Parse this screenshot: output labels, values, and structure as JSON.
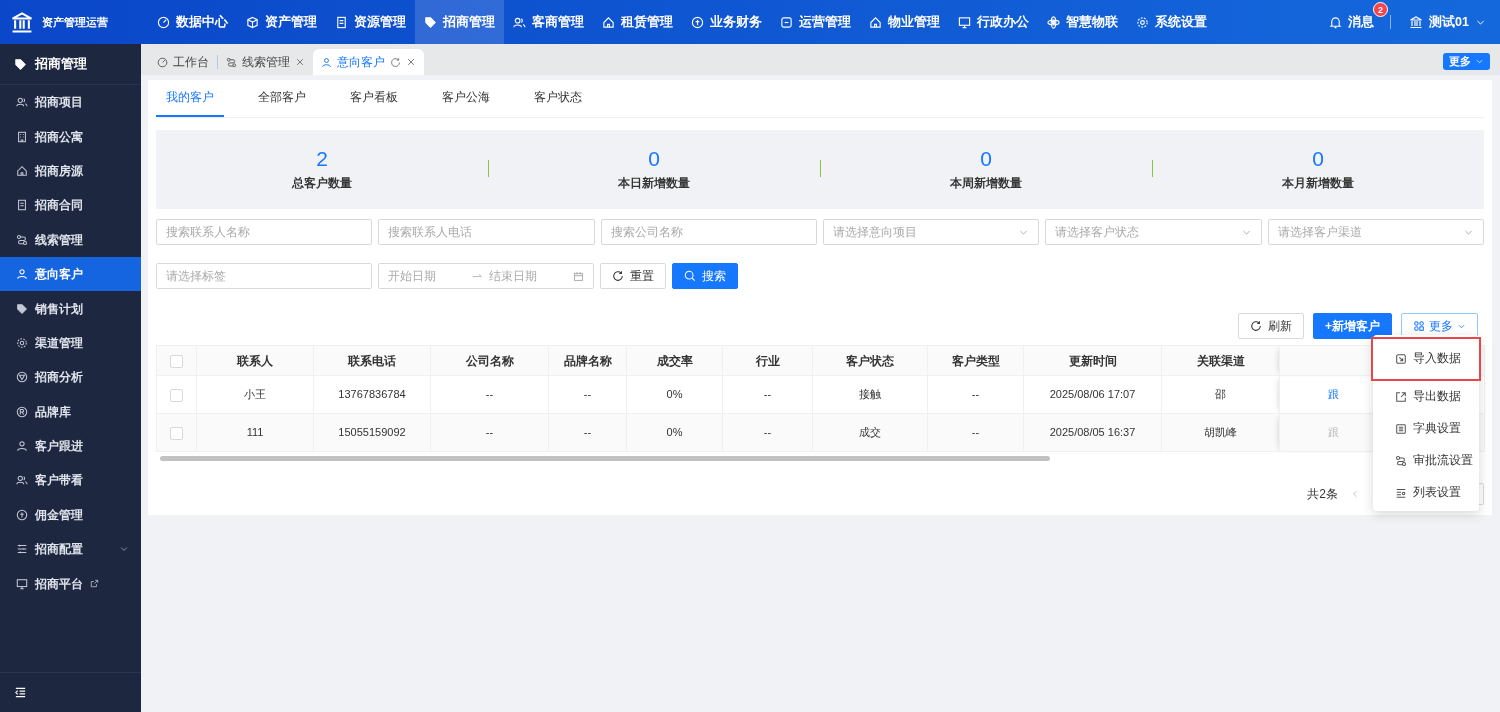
{
  "app": {
    "title": "资产管理运营"
  },
  "top_nav": [
    {
      "label": "数据中心",
      "selected": false
    },
    {
      "label": "资产管理",
      "selected": false
    },
    {
      "label": "资源管理",
      "selected": false
    },
    {
      "label": "招商管理",
      "selected": true
    },
    {
      "label": "客商管理",
      "selected": false
    },
    {
      "label": "租赁管理",
      "selected": false
    },
    {
      "label": "业务财务",
      "selected": false
    },
    {
      "label": "运营管理",
      "selected": false
    },
    {
      "label": "物业管理",
      "selected": false
    },
    {
      "label": "行政办公",
      "selected": false
    },
    {
      "label": "智慧物联",
      "selected": false
    },
    {
      "label": "系统设置",
      "selected": false
    }
  ],
  "notifications": {
    "label": "消息",
    "count": "2"
  },
  "user": {
    "name": "测试01"
  },
  "sidebar": {
    "title": "招商管理",
    "items": [
      {
        "label": "招商项目",
        "selected": false,
        "kind": "item"
      },
      {
        "label": "招商公寓",
        "selected": false,
        "kind": "item"
      },
      {
        "label": "招商房源",
        "selected": false,
        "kind": "item"
      },
      {
        "label": "招商合同",
        "selected": false,
        "kind": "item"
      },
      {
        "label": "线索管理",
        "selected": false,
        "kind": "item"
      },
      {
        "label": "意向客户",
        "selected": true,
        "kind": "item"
      },
      {
        "label": "销售计划",
        "selected": false,
        "kind": "item"
      },
      {
        "label": "渠道管理",
        "selected": false,
        "kind": "item"
      },
      {
        "label": "招商分析",
        "selected": false,
        "kind": "item"
      },
      {
        "label": "品牌库",
        "selected": false,
        "kind": "item"
      },
      {
        "label": "客户跟进",
        "selected": false,
        "kind": "item"
      },
      {
        "label": "客户带看",
        "selected": false,
        "kind": "item"
      },
      {
        "label": "佣金管理",
        "selected": false,
        "kind": "item"
      },
      {
        "label": "招商配置",
        "selected": false,
        "kind": "group"
      },
      {
        "label": "招商平台",
        "selected": false,
        "kind": "external"
      }
    ]
  },
  "page_tabs": [
    {
      "label": "工作台",
      "selected": false,
      "closable": false
    },
    {
      "label": "线索管理",
      "selected": false,
      "closable": true
    },
    {
      "label": "意向客户",
      "selected": true,
      "closable": true
    }
  ],
  "page_tabs_more": "更多",
  "sub_tabs": [
    {
      "label": "我的客户",
      "selected": true
    },
    {
      "label": "全部客户",
      "selected": false
    },
    {
      "label": "客户看板",
      "selected": false
    },
    {
      "label": "客户公海",
      "selected": false
    },
    {
      "label": "客户状态",
      "selected": false
    }
  ],
  "stats": [
    {
      "value": "2",
      "label": "总客户数量"
    },
    {
      "value": "0",
      "label": "本日新增数量"
    },
    {
      "value": "0",
      "label": "本周新增数量"
    },
    {
      "value": "0",
      "label": "本月新增数量"
    }
  ],
  "filters": [
    {
      "placeholder": "搜索联系人名称",
      "kind": "text"
    },
    {
      "placeholder": "搜索联系人电话",
      "kind": "text"
    },
    {
      "placeholder": "搜索公司名称",
      "kind": "text"
    },
    {
      "placeholder": "请选择意向项目",
      "kind": "select"
    },
    {
      "placeholder": "请选择客户状态",
      "kind": "select"
    },
    {
      "placeholder": "请选择客户渠道",
      "kind": "select"
    }
  ],
  "tag_filter": {
    "placeholder": "请选择标签"
  },
  "date_range": {
    "start_placeholder": "开始日期",
    "end_placeholder": "结束日期"
  },
  "reset_button": "重置",
  "search_button": "搜索",
  "toolbar": {
    "refresh": "刷新",
    "add": "+新增客户",
    "more": "更多"
  },
  "table": {
    "all_selected": false,
    "columns": [
      "联系人",
      "联系电话",
      "公司名称",
      "品牌名称",
      "成交率",
      "行业",
      "客户状态",
      "客户类型",
      "更新时间",
      "关联渠道"
    ],
    "rows": [
      {
        "selected": false,
        "cells": [
          "小王",
          "13767836784",
          "--",
          "--",
          "0%",
          "--",
          "接触",
          "--",
          "2025/08/06 17:07",
          "邵"
        ],
        "action": "跟",
        "action_enabled": true
      },
      {
        "selected": false,
        "cells": [
          "111",
          "15055159092",
          "--",
          "--",
          "0%",
          "--",
          "成交",
          "--",
          "2025/08/05 16:37",
          "胡凯峰"
        ],
        "action": "跟",
        "action_enabled": false
      }
    ]
  },
  "pagination": {
    "total": "共2条"
  },
  "more_menu": [
    {
      "label": "导入数据",
      "highlighted": true
    },
    {
      "label": "导出数据",
      "highlighted": false
    },
    {
      "label": "字典设置",
      "highlighted": false
    },
    {
      "label": "审批流设置",
      "highlighted": false
    },
    {
      "label": "列表设置",
      "highlighted": false
    }
  ]
}
